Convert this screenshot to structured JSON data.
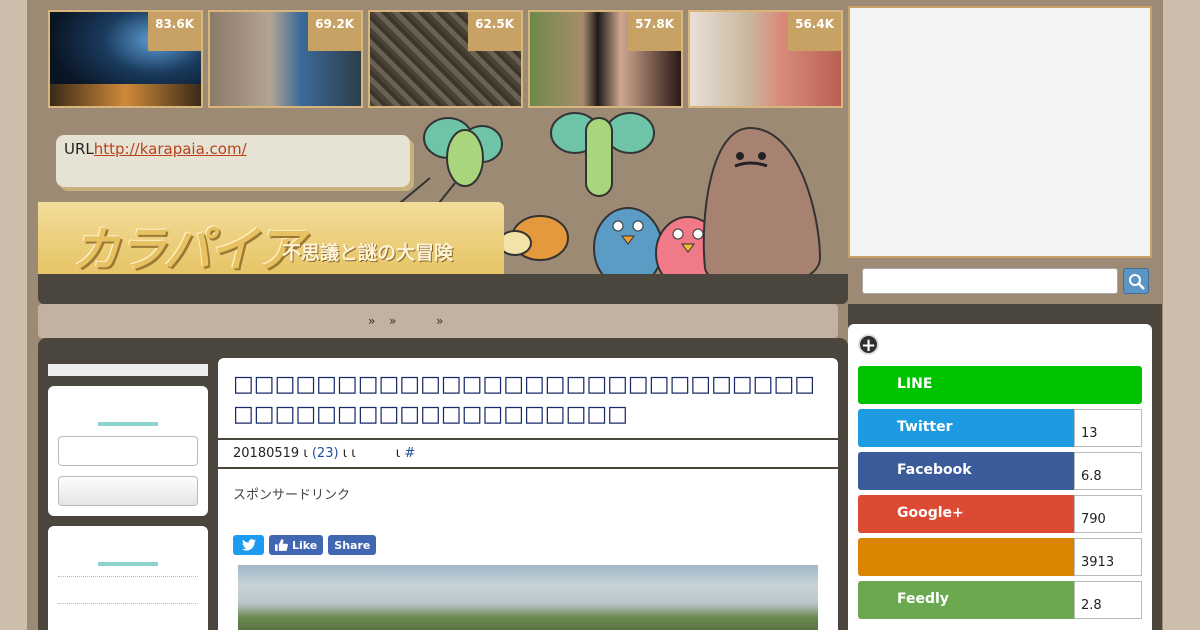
{
  "thumbnails": [
    {
      "count": "83.6K"
    },
    {
      "count": "69.2K"
    },
    {
      "count": "62.5K"
    },
    {
      "count": "57.8K"
    },
    {
      "count": "56.4K"
    }
  ],
  "header": {
    "url_prefix": "URL",
    "url_link": "http://karapaia.com/",
    "logo_text": "カラパイア",
    "logo_subtitle": "不思議と謎の大冒険"
  },
  "breadcrumb": {
    "sep1": "»",
    "sep2": "»",
    "sep3": "»"
  },
  "article": {
    "title": "□□□□□□□□□□□□□□□□□□□□□□□□□□□□□□□□□□□□□□□□□□□□□□□",
    "meta_date": "20180519",
    "meta_sep1": "ι",
    "meta_comments": "(23)",
    "meta_sep2": "ι ι",
    "meta_sep3": "ι",
    "meta_hash": "#",
    "sponsor": "スポンサードリンク",
    "like_label": "Like",
    "share_label": "Share"
  },
  "share_panel": {
    "items": [
      {
        "label": "LINE",
        "count": "",
        "color": "#00c300"
      },
      {
        "label": "Twitter",
        "count": "13",
        "color": "#1d9be2"
      },
      {
        "label": "Facebook",
        "count": "6.8",
        "color": "#3b5b9a"
      },
      {
        "label": "Google+",
        "count": "790",
        "color": "#dd4a33"
      },
      {
        "label": "",
        "count": "3913",
        "color": "#db8402"
      },
      {
        "label": "Feedly",
        "count": "2.8",
        "color": "#6aa950"
      }
    ]
  }
}
